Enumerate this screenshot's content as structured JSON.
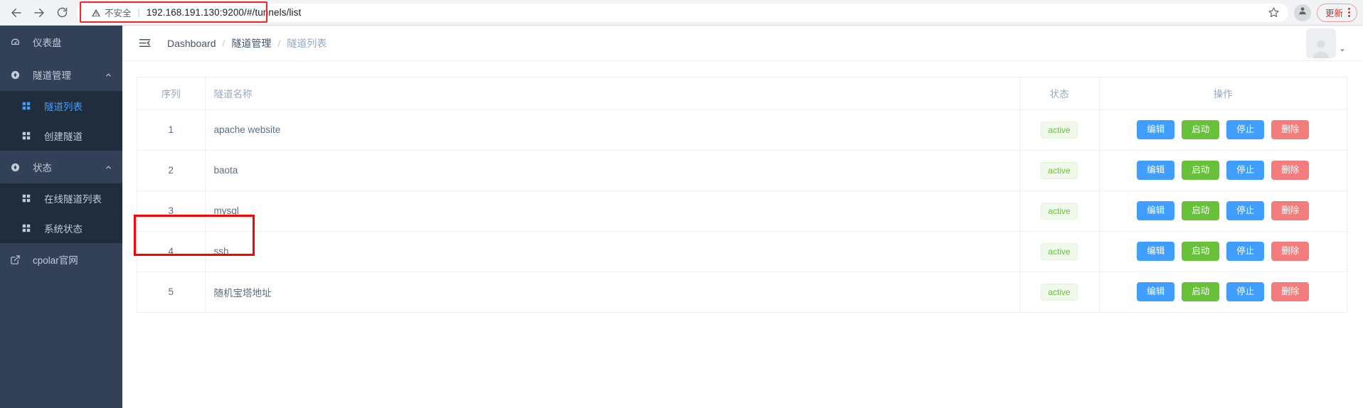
{
  "browser": {
    "back_icon": "back-arrow-icon",
    "forward_icon": "forward-arrow-icon",
    "reload_icon": "reload-icon",
    "security_text": "不安全",
    "security_icon": "warning-triangle-icon",
    "url_host": "192.168.191.130:9200",
    "url_path": "/#/tunnels/list",
    "url_full": "192.168.191.130:9200/#/tunnels/list",
    "bookmark_icon": "star-icon",
    "profile_icon": "person-avatar-icon",
    "update_label": "更新",
    "menu_icon": "kebab-menu-icon",
    "highlight_color": "#f5232a"
  },
  "sidebar": {
    "bg_color": "#324157",
    "sub_bg_color": "#1f2d3d",
    "active_color": "#409eff",
    "items": [
      {
        "label": "仪表盘",
        "icon": "dashboard-gauge-icon",
        "type": "item"
      },
      {
        "label": "隧道管理",
        "icon": "tunnel-circle-icon",
        "type": "group",
        "arrow": "chevron-up-icon"
      },
      {
        "label": "隧道列表",
        "icon": "grid-table-icon",
        "type": "sub",
        "active": true
      },
      {
        "label": "创建隧道",
        "icon": "grid-table-icon",
        "type": "sub",
        "active": false
      },
      {
        "label": "状态",
        "icon": "status-circle-icon",
        "type": "group",
        "arrow": "chevron-up-icon"
      },
      {
        "label": "在线隧道列表",
        "icon": "grid-table-icon",
        "type": "sub",
        "active": false
      },
      {
        "label": "系统状态",
        "icon": "grid-table-icon",
        "type": "sub",
        "active": false
      },
      {
        "label": "cpolar官网",
        "icon": "external-link-icon",
        "type": "link"
      }
    ]
  },
  "topbar": {
    "collapse_icon": "hamburger-collapse-icon",
    "breadcrumb": [
      "Dashboard",
      "隧道管理",
      "隧道列表"
    ],
    "separator": "/",
    "avatar_icon": "user-avatar-icon",
    "caret_icon": "caret-down-icon"
  },
  "table": {
    "columns": [
      "序列",
      "隧道名称",
      "状态",
      "操作"
    ],
    "actions": [
      {
        "label": "编辑",
        "color": "#409eff",
        "name": "edit"
      },
      {
        "label": "启动",
        "color": "#67c23a",
        "name": "start"
      },
      {
        "label": "停止",
        "color": "#409eff",
        "name": "stop"
      },
      {
        "label": "删除",
        "color": "#f37c7c",
        "name": "delete"
      }
    ],
    "rows": [
      {
        "seq": "1",
        "name": "apache website",
        "status": "active"
      },
      {
        "seq": "2",
        "name": "baota",
        "status": "active"
      },
      {
        "seq": "3",
        "name": "mysql",
        "status": "active"
      },
      {
        "seq": "4",
        "name": "ssh",
        "status": "active"
      },
      {
        "seq": "5",
        "name": "随机宝塔地址",
        "status": "active"
      }
    ],
    "status_color": "#67c23a",
    "status_bg": "#f0f9eb"
  },
  "annotation": {
    "highlighted_row_seq": "4",
    "highlighted_row_name": "ssh",
    "color": "#ff0000"
  }
}
